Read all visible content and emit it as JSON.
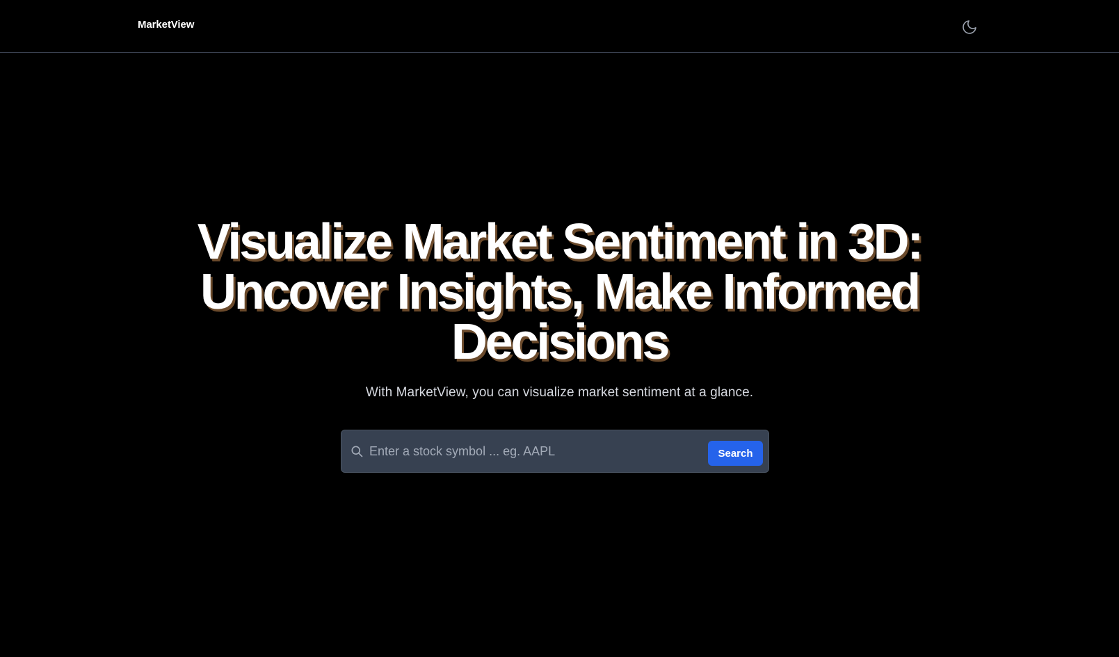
{
  "navbar": {
    "brand": "MarketView",
    "theme_toggle_icon": "moon-icon"
  },
  "hero": {
    "title": "Visualize Market Sentiment in 3D: Uncover Insights, Make Informed Decisions",
    "subtitle": "With MarketView, you can visualize market sentiment at a glance."
  },
  "search": {
    "icon": "search-icon",
    "placeholder": "Enter a stock symbol ... eg. AAPL",
    "value": "",
    "button_label": "Search"
  },
  "colors": {
    "background": "#000000",
    "accent": "#2563eb",
    "search_box": "#374151",
    "title_shadow": "#6b4a2b"
  }
}
